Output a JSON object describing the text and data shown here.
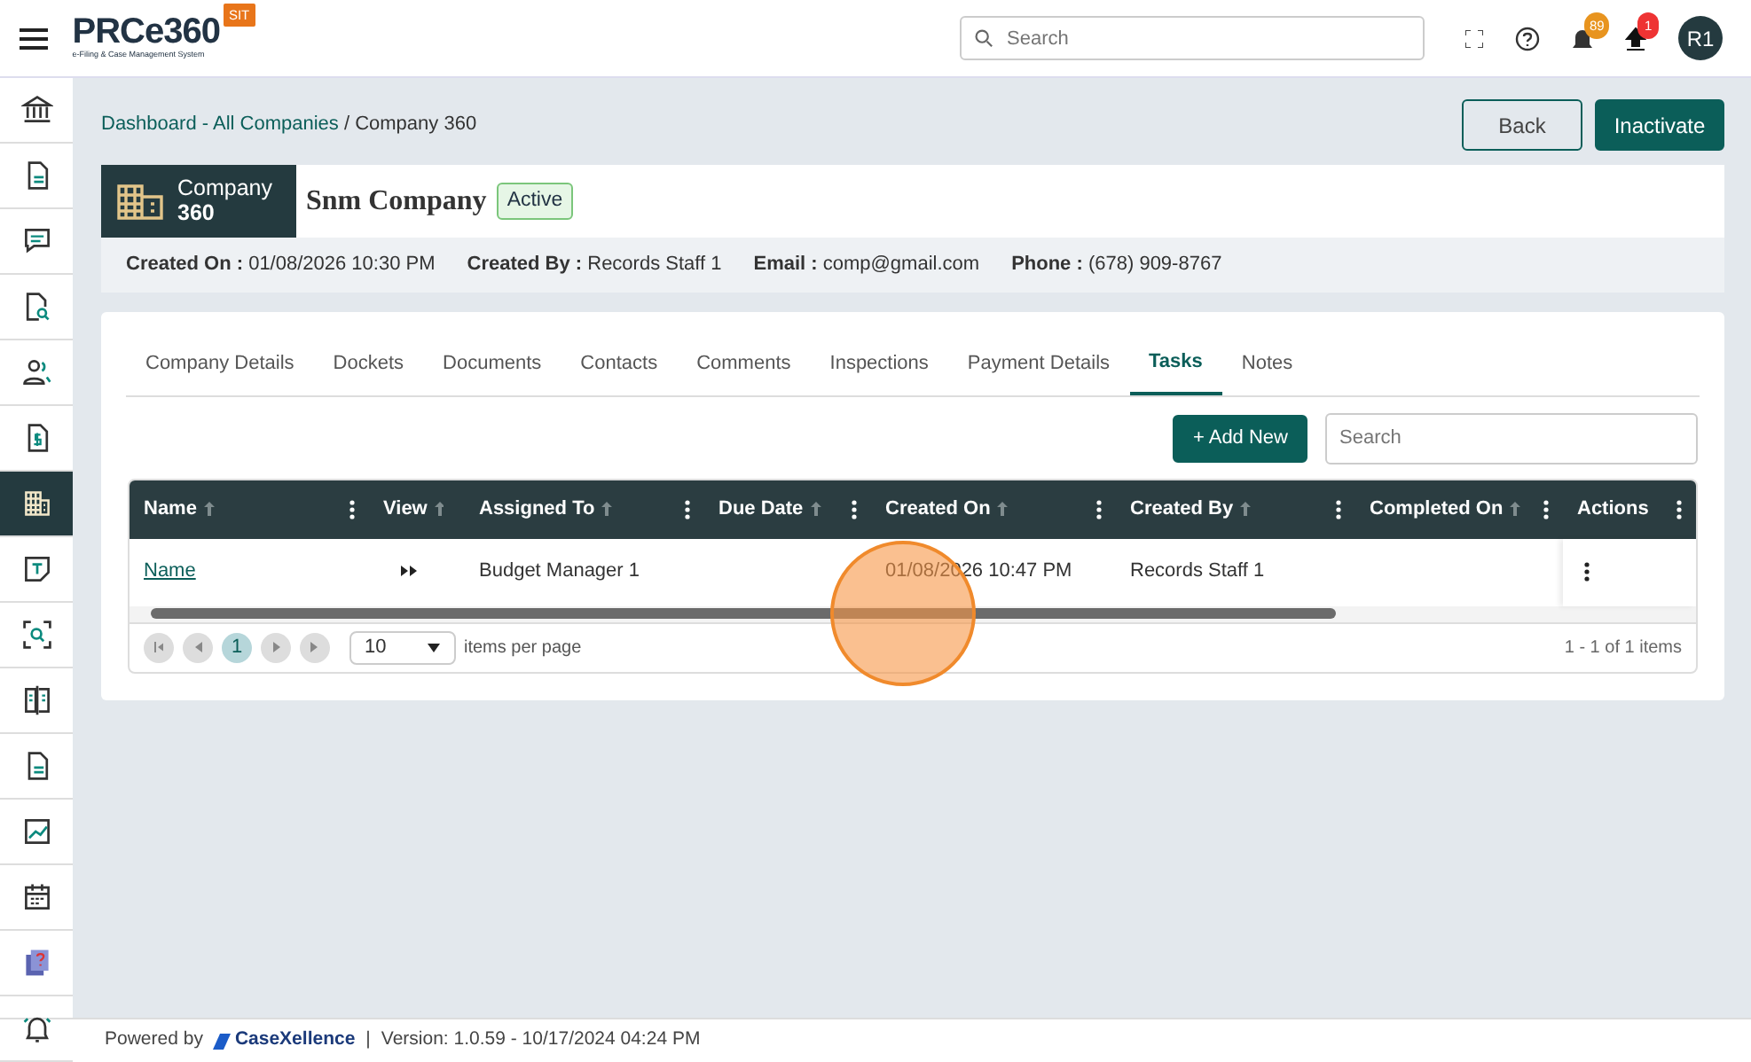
{
  "header": {
    "logo": "PRCe360",
    "tagline": "e-Filing & Case Management System",
    "env_badge": "SIT",
    "search": {
      "placeholder": "Search"
    },
    "notification_count": "89",
    "upload_count": "1",
    "avatar": "R1"
  },
  "sidebar": {
    "items": [
      {
        "kind": "bank",
        "selected": false
      },
      {
        "kind": "document",
        "selected": false
      },
      {
        "kind": "chat",
        "selected": false
      },
      {
        "kind": "doc-search",
        "selected": false
      },
      {
        "kind": "people",
        "selected": false
      },
      {
        "kind": "dollar-doc",
        "selected": false
      },
      {
        "kind": "building",
        "selected": true
      },
      {
        "kind": "note",
        "selected": false
      },
      {
        "kind": "scan",
        "selected": false
      },
      {
        "kind": "book",
        "selected": false
      },
      {
        "kind": "document",
        "selected": false
      },
      {
        "kind": "chart",
        "selected": false
      },
      {
        "kind": "calendar",
        "selected": false
      },
      {
        "kind": "help-stack",
        "selected": false
      },
      {
        "kind": "alarm",
        "selected": false
      }
    ]
  },
  "breadcrumb": [
    {
      "text": "Dashboard - All Companies",
      "link": true
    },
    {
      "text": "/ Company 360",
      "link": false
    }
  ],
  "actions": [
    "Back",
    "Inactivate"
  ],
  "company": {
    "label": "Company",
    "number": "360",
    "name": "Snm Company",
    "status": "Active"
  },
  "details": [
    {
      "label": "Created On :",
      "value": "01/08/2026 10:30 PM"
    },
    {
      "label": "Created By :",
      "value": "Records Staff 1"
    },
    {
      "label": "Email :",
      "value": "comp@gmail.com"
    },
    {
      "label": "Phone :",
      "value": "(678) 909-8767"
    }
  ],
  "tabs": [
    {
      "label": "Company Details",
      "selected": false
    },
    {
      "label": "Dockets",
      "selected": false
    },
    {
      "label": "Documents",
      "selected": false
    },
    {
      "label": "Contacts",
      "selected": false
    },
    {
      "label": "Comments",
      "selected": false
    },
    {
      "label": "Inspections",
      "selected": false
    },
    {
      "label": "Payment Details",
      "selected": false
    },
    {
      "label": "Tasks",
      "selected": true
    },
    {
      "label": "Notes",
      "selected": false
    }
  ],
  "toolbar": {
    "add_button": "+ Add New",
    "search": {
      "placeholder": "Search"
    }
  },
  "table": {
    "columns": [
      {
        "label": "Name",
        "sortable": true,
        "menu": true
      },
      {
        "label": "View",
        "sortable": true,
        "menu": false
      },
      {
        "label": "Assigned To",
        "sortable": true,
        "menu": true
      },
      {
        "label": "Due Date",
        "sortable": true,
        "menu": true
      },
      {
        "label": "Created On",
        "sortable": true,
        "menu": true
      },
      {
        "label": "Created By",
        "sortable": true,
        "menu": true
      },
      {
        "label": "Completed On",
        "sortable": true,
        "menu": true
      },
      {
        "label": "Actions",
        "sortable": false,
        "menu": true
      }
    ],
    "rows": [
      {
        "name": "Name",
        "assigned_to": "Budget Manager 1",
        "created_on": "01/08/2026 10:47 PM",
        "created_by": "Records Staff 1"
      }
    ]
  },
  "pager": {
    "pages": [
      {
        "label": "1",
        "selected": true
      }
    ],
    "page_size": "10",
    "page_size_label": "items per page",
    "summary": "1 - 1 of 1 items"
  },
  "footer": {
    "powered_by": "Powered by",
    "brand": "CaseXellence",
    "separator": "|",
    "version": "Version: 1.0.59 - 10/17/2024 04:24 PM"
  }
}
